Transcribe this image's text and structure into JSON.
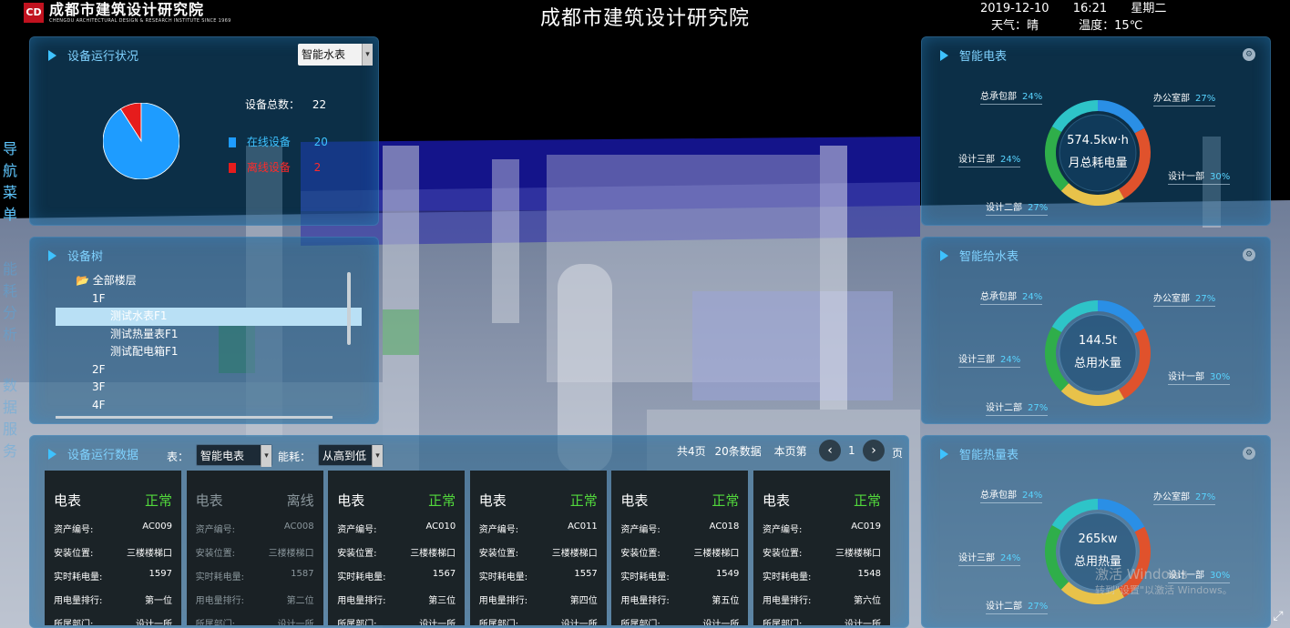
{
  "header": {
    "logo_mark": "CDAD",
    "logo_cn": "成都市建筑设计研究院",
    "logo_en": "CHENGDU ARCHITECTURAL DESIGN & RESEARCH INSTITUTE SINCE 1969",
    "title": "成都市建筑设计研究院",
    "date": "2019-12-10",
    "time": "16:21",
    "weekday": "星期二",
    "weather": "天气：晴",
    "temperature": "温度：15℃"
  },
  "side_nav": [
    "导航菜单",
    "能耗分析",
    "数据服务"
  ],
  "device_status": {
    "title": "设备运行状况",
    "selector": "智能水表",
    "total_label": "设备总数：",
    "total": "22",
    "online_label": "在线设备",
    "online": "20",
    "offline_label": "离线设备",
    "offline": "2",
    "colors": {
      "online": "#1e9cff",
      "offline": "#e61c1c"
    }
  },
  "device_tree": {
    "title": "设备树",
    "rows": [
      "全部楼层",
      "1F",
      "测试水表F1",
      "测试热量表F1",
      "测试配电箱F1",
      "2F",
      "3F",
      "4F"
    ]
  },
  "device_data": {
    "title": "设备运行数据",
    "type_label": "表：",
    "type_value": "智能电表",
    "energy_label": "能耗：",
    "energy_value": "从高到低",
    "pages": "共4页",
    "records": "20条数据",
    "current_page_label": "本页第",
    "page": "1",
    "page_suffix": "页",
    "prev": "‹",
    "next": "›",
    "field_labels": [
      "资产编号:",
      "安装位置:",
      "实时耗电量:",
      "用电量排行:",
      "所属部门:"
    ],
    "cards": [
      {
        "type": "电表",
        "status": "正常",
        "asset": "AC009",
        "location": "三楼楼梯口",
        "power": "1597",
        "rank": "第一位",
        "dept": "设计一所"
      },
      {
        "type": "电表",
        "status": "离线",
        "asset": "AC008",
        "location": "三楼楼梯口",
        "power": "1587",
        "rank": "第二位",
        "dept": "设计一所"
      },
      {
        "type": "电表",
        "status": "正常",
        "asset": "AC010",
        "location": "三楼楼梯口",
        "power": "1567",
        "rank": "第三位",
        "dept": "设计一所"
      },
      {
        "type": "电表",
        "status": "正常",
        "asset": "AC011",
        "location": "三楼楼梯口",
        "power": "1557",
        "rank": "第四位",
        "dept": "设计一所"
      },
      {
        "type": "电表",
        "status": "正常",
        "asset": "AC018",
        "location": "三楼楼梯口",
        "power": "1549",
        "rank": "第五位",
        "dept": "设计一所"
      },
      {
        "type": "电表",
        "status": "正常",
        "asset": "AC019",
        "location": "三楼楼梯口",
        "power": "1548",
        "rank": "第六位",
        "dept": "设计一所"
      }
    ]
  },
  "meters": [
    {
      "title": "智能电表",
      "value": "574.5kw·h",
      "label": "月总耗电量",
      "segments": [
        {
          "name": "办公室部",
          "pct": "27%"
        },
        {
          "name": "设计一部",
          "pct": "30%"
        },
        {
          "name": "设计二部",
          "pct": "27%"
        },
        {
          "name": "设计三部",
          "pct": "24%"
        },
        {
          "name": "总承包部",
          "pct": "24%"
        }
      ]
    },
    {
      "title": "智能给水表",
      "value": "144.5t",
      "label": "总用水量",
      "segments": [
        {
          "name": "办公室部",
          "pct": "27%"
        },
        {
          "name": "设计一部",
          "pct": "30%"
        },
        {
          "name": "设计二部",
          "pct": "27%"
        },
        {
          "name": "设计三部",
          "pct": "24%"
        },
        {
          "name": "总承包部",
          "pct": "24%"
        }
      ]
    },
    {
      "title": "智能热量表",
      "value": "265kw",
      "label": "总用热量",
      "segments": [
        {
          "name": "办公室部",
          "pct": "27%"
        },
        {
          "name": "设计一部",
          "pct": "30%"
        },
        {
          "name": "设计二部",
          "pct": "27%"
        },
        {
          "name": "设计三部",
          "pct": "24%"
        },
        {
          "name": "总承包部",
          "pct": "24%"
        }
      ]
    }
  ],
  "ring_colors": [
    "#2a8fe6",
    "#e0522c",
    "#e8c24a",
    "#2fae4a",
    "#2ec4c8"
  ],
  "watermark": "激活 Windows",
  "watermark_sub": "转到\"设置\"以激活 Windows。"
}
